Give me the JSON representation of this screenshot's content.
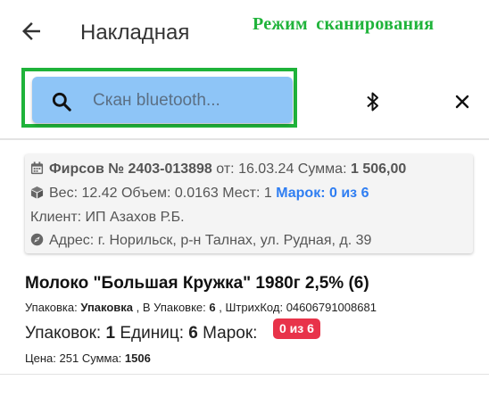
{
  "header": {
    "title": "Накладная",
    "mode_label": "Режим  сканирования",
    "back_icon": "arrow-left-icon"
  },
  "search": {
    "placeholder": "Скан bluetooth...",
    "value": "",
    "icons": [
      "search-icon",
      "bluetooth-icon",
      "close-icon"
    ]
  },
  "document": {
    "client_name": "Фирсов",
    "number": "№ 2403-013898",
    "from_label": "от:",
    "date": "16.03.24",
    "sum_label": "Сумма:",
    "sum_value": "1 506,00",
    "weight_label": "Вес:",
    "weight_value": "12.42",
    "volume_label": "Объем:",
    "volume_value": "0.0163",
    "places_label": "Мест:",
    "places_value": "1",
    "marks_text": "Марок: 0 из 6",
    "client_line": "Клиент: ИП Азахов Р.Б.",
    "address_line": "Адрес: г. Норильск, р-н Талнах, ул. Рудная, д. 39",
    "colors": {
      "link": "#2f7ef2"
    }
  },
  "product": {
    "title": "Молоко \"Большая Кружка\" 1980г 2,5% (6)",
    "pack_label": "Упаковка:",
    "pack_value": "Упаковка",
    "in_pack_label": ", В Упаковке:",
    "in_pack_value": "6",
    "barcode_label": ", ШтрихКод:",
    "barcode_value": "04606791008681",
    "packs_label": "Упаковок:",
    "packs_value": "1",
    "units_label": "Единиц:",
    "units_value": "6",
    "marks_label": "Марок:",
    "marks_badge": "0 из 6",
    "price_label": "Цена:",
    "price_value": "251",
    "sum_label": "Сумма:",
    "sum_value": "1506",
    "colors": {
      "badge": "#e8334a",
      "mode": "#1fb33a",
      "search_bg": "#8ec5f7"
    }
  }
}
